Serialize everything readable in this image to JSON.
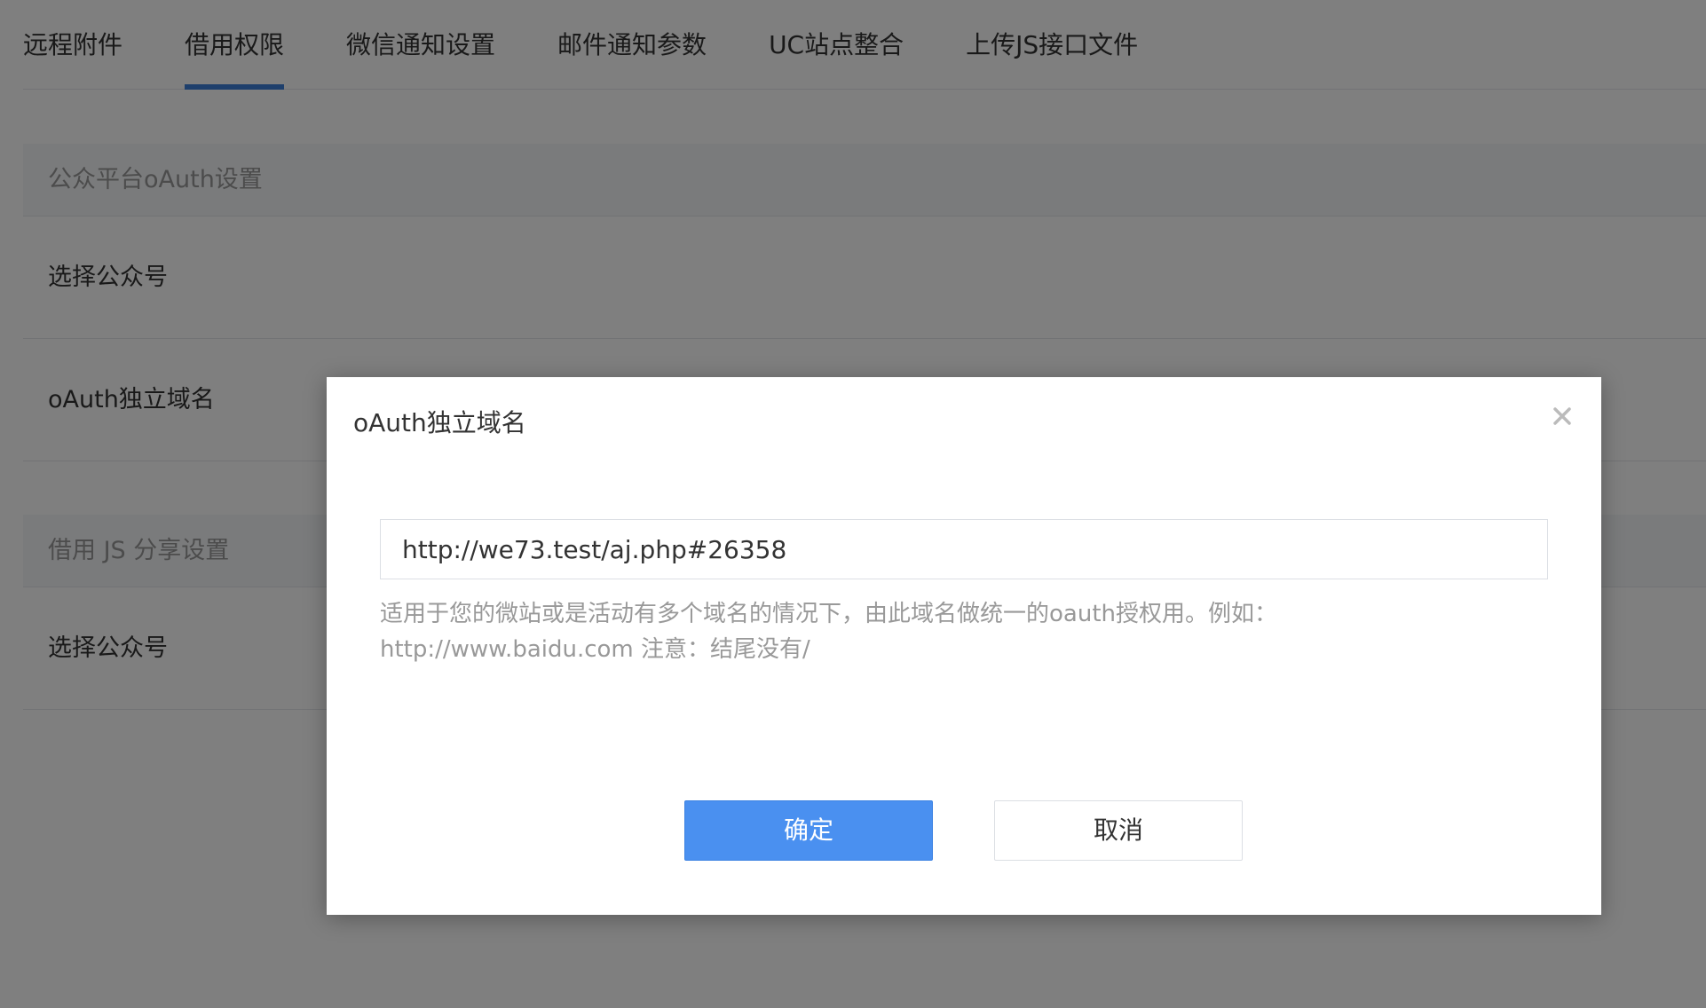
{
  "tabs": [
    {
      "label": "远程附件"
    },
    {
      "label": "借用权限"
    },
    {
      "label": "微信通知设置"
    },
    {
      "label": "邮件通知参数"
    },
    {
      "label": "UC站点整合"
    },
    {
      "label": "上传JS接口文件"
    }
  ],
  "active_tab": "借用权限",
  "sections": {
    "oauth": {
      "title": "公众平台oAuth设置",
      "rows": [
        {
          "label": "选择公众号"
        },
        {
          "label": "oAuth独立域名"
        }
      ]
    },
    "js_share": {
      "title": "借用 JS 分享设置",
      "rows": [
        {
          "label": "选择公众号"
        }
      ]
    }
  },
  "modal": {
    "title": "oAuth独立域名",
    "input_value": "http://we73.test/aj.php#26358",
    "help_line1": "适用于您的微站或是活动有多个域名的情况下，由此域名做统一的oauth授权用。例如：",
    "help_line2": "http://www.baidu.com 注意：结尾没有/",
    "confirm_label": "确定",
    "cancel_label": "取消"
  },
  "colors": {
    "accent": "#4a90f0",
    "tab_indicator": "#3d7fd8",
    "overlay": "rgba(0,0,0,0.5)"
  },
  "icons": {
    "close": "close-icon"
  }
}
